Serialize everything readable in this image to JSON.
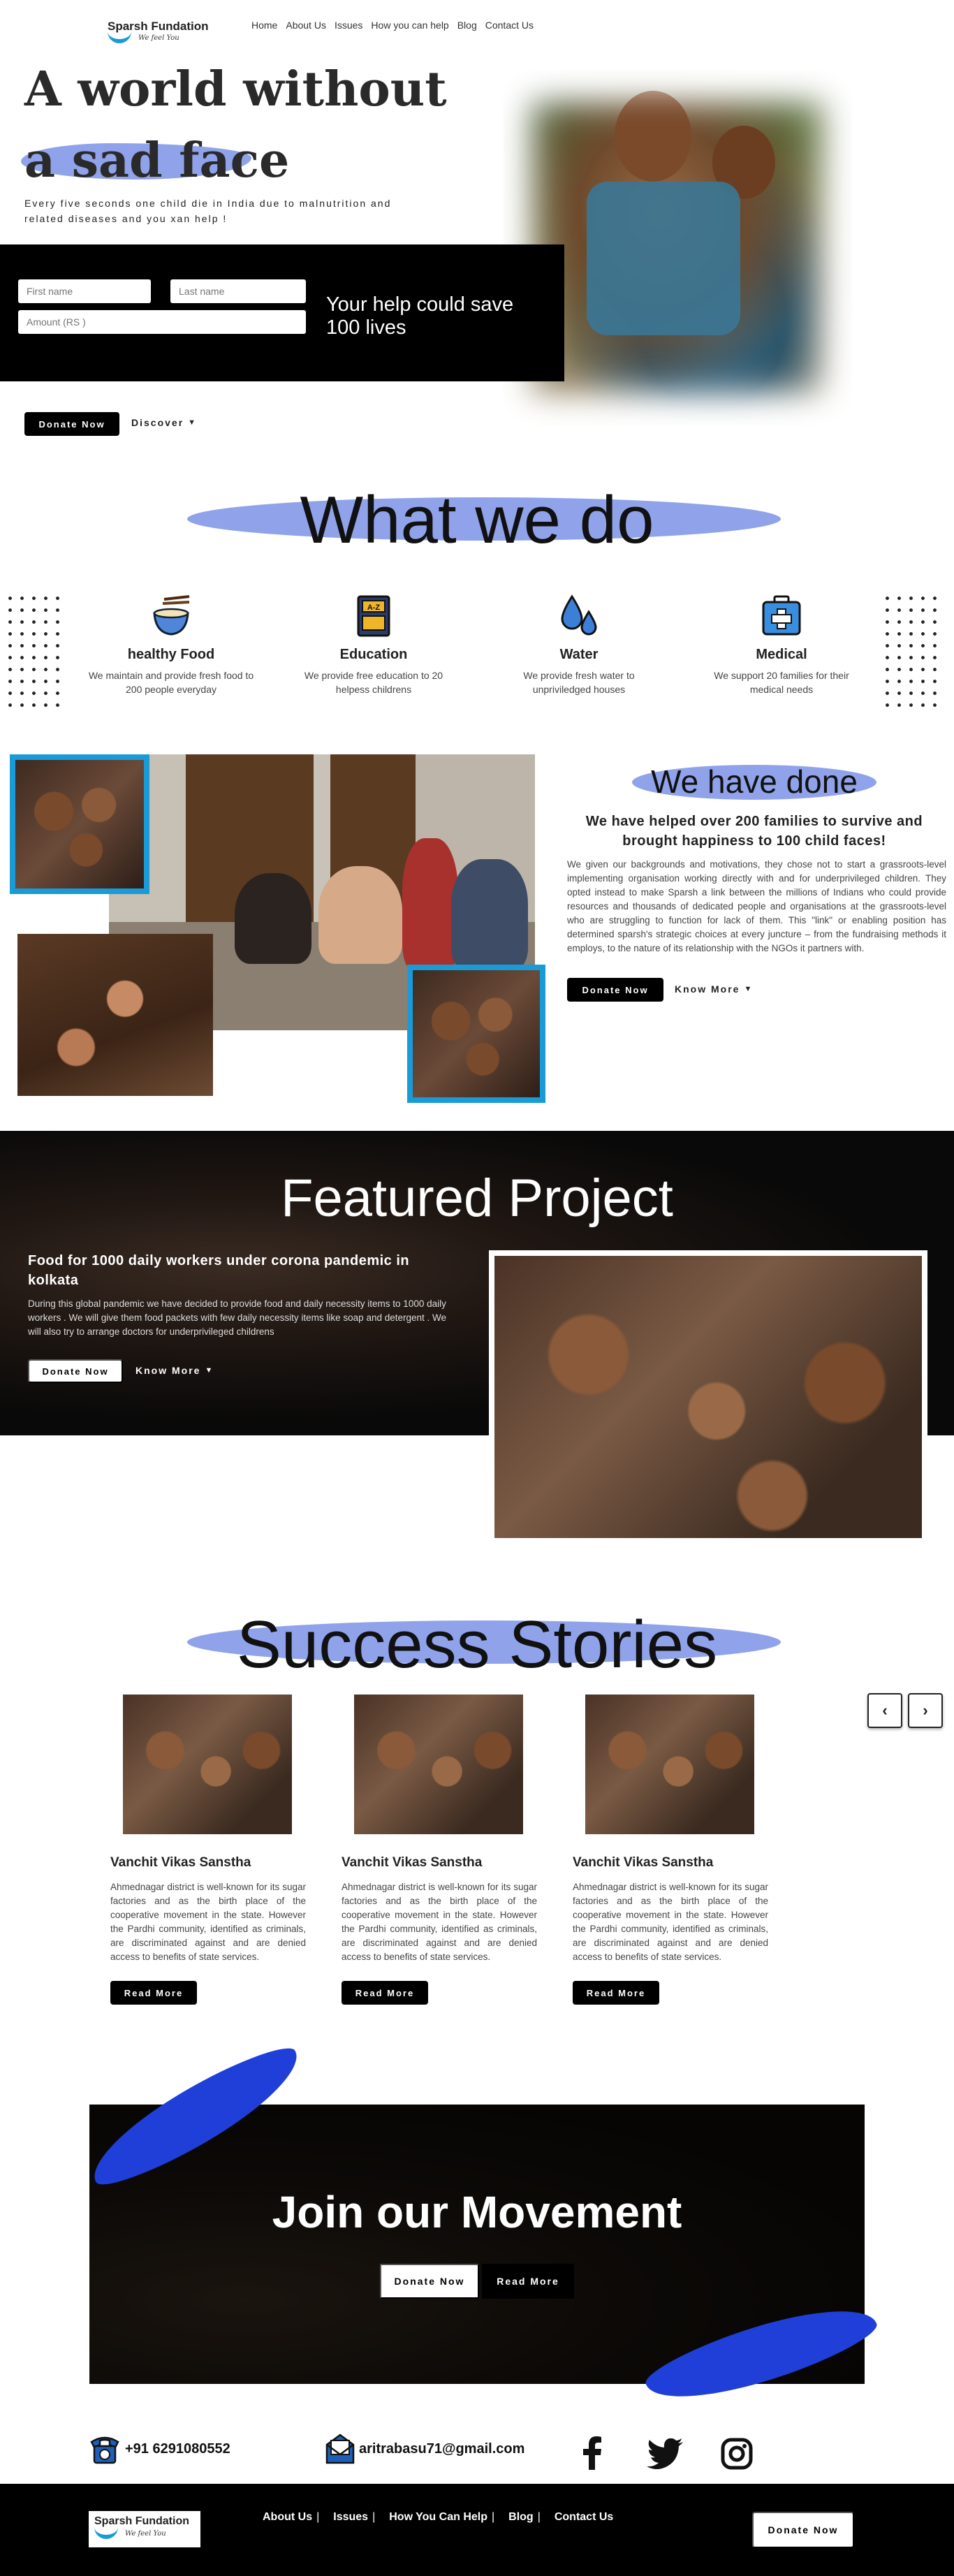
{
  "nav": {
    "logo_name": "Sparsh Fundation",
    "logo_tagline": "We feel You",
    "links": [
      "Home",
      "About Us",
      "Issues",
      "How you can help",
      "Blog",
      "Contact Us"
    ]
  },
  "hero": {
    "title_line1": "A world without",
    "title_line2": "a sad face",
    "subtitle_line1": "Every five seconds one child die in India due to malnutrition and",
    "subtitle_line2": "related diseases and you xan help !",
    "first_name_placeholder": "First name",
    "last_name_placeholder": "Last name",
    "amount_placeholder": "Amount (RS )",
    "help_text_line1": "Your help could save",
    "help_text_line2": "100 lives",
    "donate_label": "Donate Now",
    "discover_label": "Discover"
  },
  "what_we_do": {
    "title": "What we do",
    "services": [
      {
        "icon": "food-bowl-icon",
        "title": "healthy Food",
        "line1": "We maintain and provide fresh food to",
        "line2": "200 people everyday"
      },
      {
        "icon": "book-icon",
        "title": "Education",
        "line1": "We provide free education to 20",
        "line2": "helpess childrens"
      },
      {
        "icon": "water-drops-icon",
        "title": "Water",
        "line1": "We provide fresh water to",
        "line2": "unpriviledged houses"
      },
      {
        "icon": "medical-kit-icon",
        "title": "Medical",
        "line1": "We support 20 families for their",
        "line2": "medical needs"
      }
    ]
  },
  "done": {
    "title": "We have done",
    "subtitle_line1": "We have helped over 200 families to survive and",
    "subtitle_line2": "brought happiness to 100 child faces!",
    "body": "We given our backgrounds and motivations, they chose not to start a grassroots-level implementing organisation working directly with and for underprivileged children. They opted instead to make Sparsh a link between the millions of Indians who could provide resources and thousands of dedicated people and organisations at the grassroots-level who are struggling to function for lack of them. This \"link\" or enabling position has determined sparsh's strategic choices at every juncture – from the fundraising methods it employs, to the nature of its relationship with the NGOs it partners with.",
    "donate_label": "Donate Now",
    "know_more_label": "Know More"
  },
  "featured": {
    "title": "Featured Project",
    "project_title_line1": "Food for 1000 daily workers under corona pandemic in",
    "project_title_line2": "kolkata",
    "body_line1": "During this global pandemic we have decided to provide food and daily necessity items to 1000 daily",
    "body_line2": "workers . We will give them food packets with few daily necessity items like soap and detergent . We",
    "body_line3": "will also try to arrange doctors for underprivileged childrens",
    "donate_label": "Donate Now",
    "know_more_label": "Know More"
  },
  "stories": {
    "title": "Success Stories",
    "items": [
      {
        "title": "Vanchit Vikas Sanstha",
        "body": "Ahmednagar district is well-known for its sugar factories and as the birth place of the cooperative movement in the state. However the Pardhi community, identified as criminals, are discriminated against and are denied access to benefits of state services.",
        "button": "Read More"
      },
      {
        "title": "Vanchit Vikas Sanstha",
        "body": "Ahmednagar district is well-known for its sugar factories and as the birth place of the cooperative movement in the state. However the Pardhi community, identified as criminals, are discriminated against and are denied access to benefits of state services.",
        "button": "Read More"
      },
      {
        "title": "Vanchit Vikas Sanstha",
        "body": "Ahmednagar district is well-known for its sugar factories and as the birth place of the cooperative movement in the state. However the Pardhi community, identified as criminals, are discriminated against and are denied access to benefits of state services.",
        "button": "Read More"
      }
    ]
  },
  "join": {
    "title": "Join our Movement",
    "donate_label": "Donate Now",
    "read_more_label": "Read More"
  },
  "contact": {
    "phone": "+91 6291080552",
    "email": "aritrabasu71@gmail.com"
  },
  "footer": {
    "logo_name": "Sparsh Fundation",
    "logo_tagline": "We feel You",
    "links": [
      "About Us",
      "Issues",
      "How You Can Help",
      "Blog",
      "Contact Us"
    ],
    "donate_label": "Donate Now"
  },
  "colors": {
    "accent_blue": "#7d93e6",
    "frame_blue": "#1a9bd7",
    "brush_blue": "#1f3fd8",
    "dark": "#000000"
  }
}
